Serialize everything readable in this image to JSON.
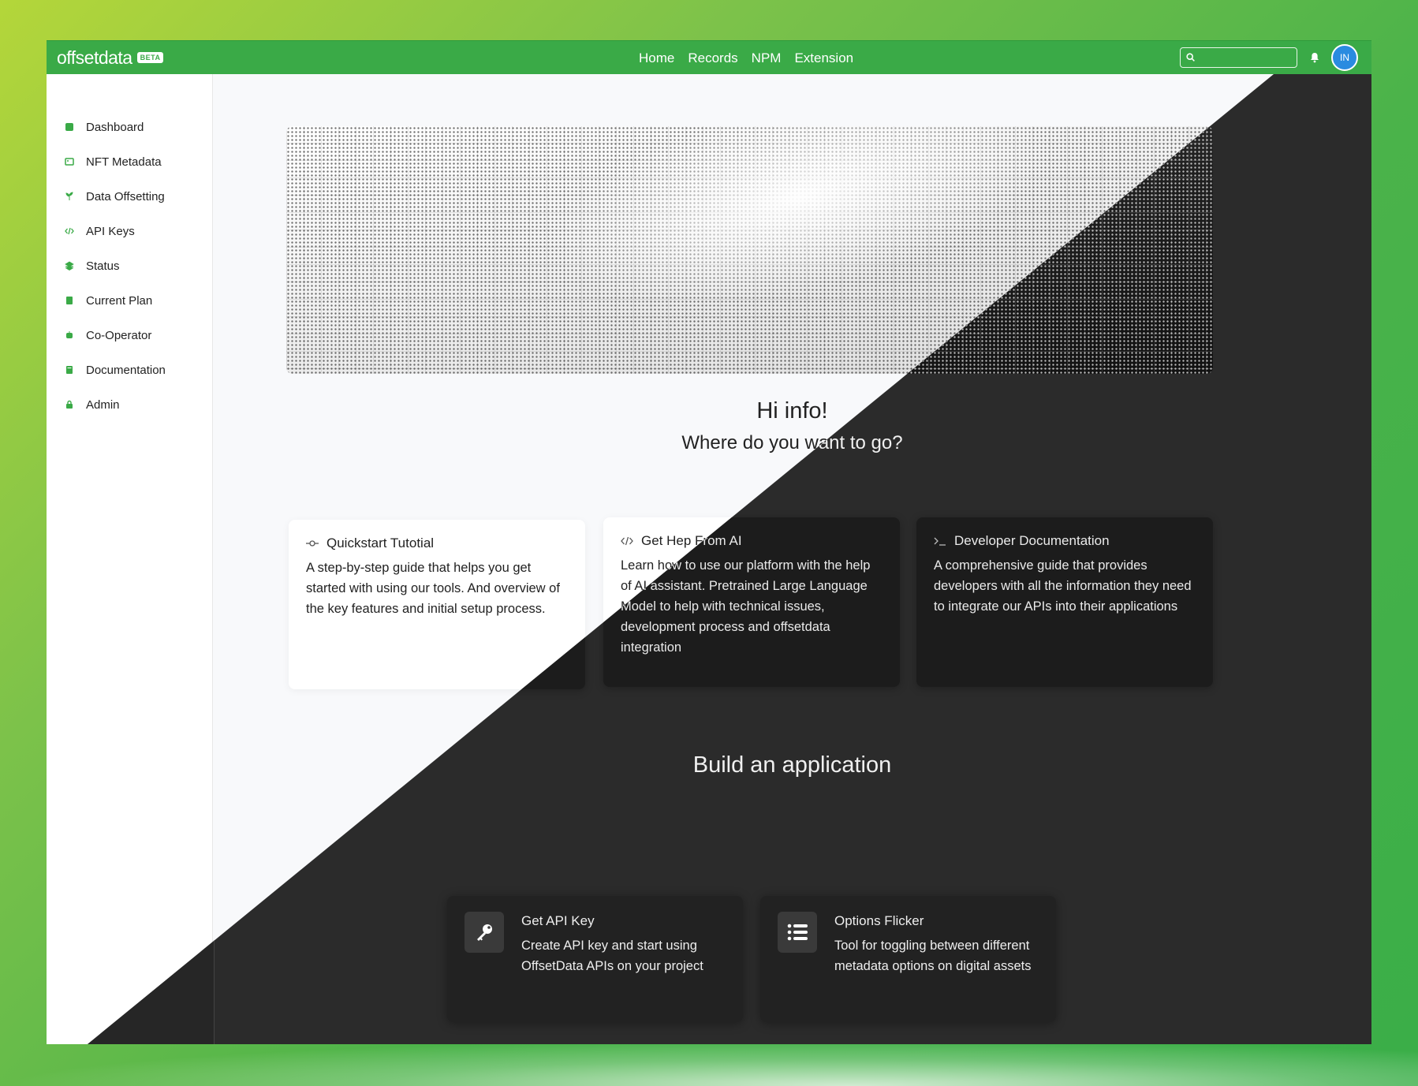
{
  "brand": {
    "name": "offsetdata",
    "badge": "BETA"
  },
  "topnav": [
    "Home",
    "Records",
    "NPM",
    "Extension"
  ],
  "search": {
    "value": "",
    "placeholder": ""
  },
  "user": {
    "initials": "IN"
  },
  "sidebar": {
    "items": [
      {
        "label": "Dashboard",
        "icon": "dashboard-icon"
      },
      {
        "label": "NFT Metadata",
        "icon": "image-icon"
      },
      {
        "label": "Data Offsetting",
        "icon": "seedling-icon"
      },
      {
        "label": "API Keys",
        "icon": "code-icon"
      },
      {
        "label": "Status",
        "icon": "layers-icon"
      },
      {
        "label": "Current Plan",
        "icon": "receipt-icon"
      },
      {
        "label": "Co-Operator",
        "icon": "robot-icon"
      },
      {
        "label": "Documentation",
        "icon": "book-icon"
      },
      {
        "label": "Admin",
        "icon": "lock-icon"
      }
    ]
  },
  "greeting": {
    "hi": "Hi info!",
    "question": "Where do you want to go?"
  },
  "cards": [
    {
      "title": "Quickstart Tutotial",
      "icon": "commit-icon",
      "body": "A step-by-step guide that helps you get started with using our tools. And overview of the key features and initial setup process."
    },
    {
      "title": "Get Hep From AI",
      "icon": "code-icon",
      "body": "Learn how to use our platform with the help of AI assistant. Pretrained Large Language Model to help with technical issues, development process and offsetdata integration"
    },
    {
      "title": "Developer Documentation",
      "icon": "terminal-icon",
      "body": "A comprehensive guide that provides developers with all the information they need to integrate our APIs into their applications"
    }
  ],
  "build": {
    "title": "Build an application",
    "apps": [
      {
        "title": "Get API Key",
        "icon": "key-icon",
        "body": "Create API key and start using OffsetData APIs on your project"
      },
      {
        "title": "Options Flicker",
        "icon": "list-icon",
        "body": "Tool for toggling between different metadata options on digital assets"
      }
    ]
  },
  "colors": {
    "brand_green": "#3aaa47",
    "dark_bg": "#2b2b2b",
    "light_bg": "#f8f9fb",
    "avatar_blue": "#2a8be0"
  }
}
